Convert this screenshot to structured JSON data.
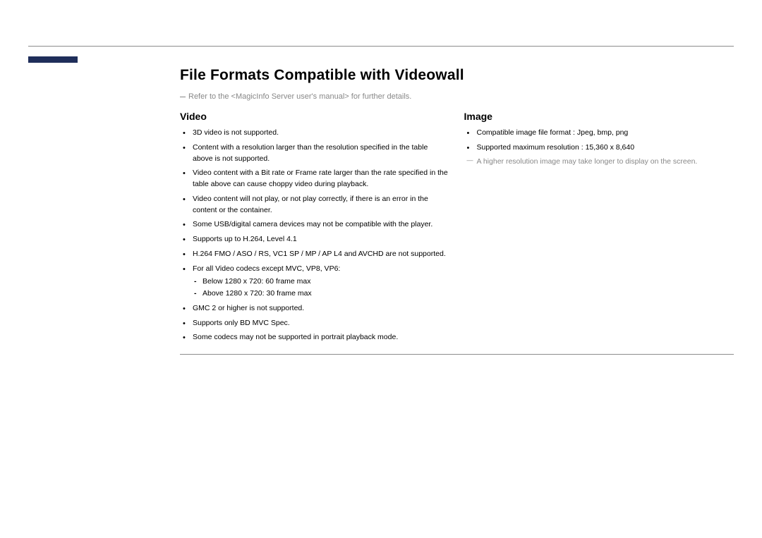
{
  "heading": "File Formats Compatible with Videowall",
  "note": "Refer to the <MagicInfo Server user's manual> for further details.",
  "video": {
    "title": "Video",
    "items": [
      "3D video is not supported.",
      "Content with a resolution larger than the resolution specified in the table above is not supported.",
      "Video content with a Bit rate or Frame rate larger than the rate specified in the table above can cause choppy video during playback.",
      "Video content will not play, or not play correctly, if there is an error in the content or the container.",
      "Some USB/digital camera devices may not be compatible with the player.",
      "Supports up to H.264, Level 4.1",
      "H.264 FMO / ASO / RS, VC1 SP / MP / AP L4 and AVCHD are not supported.",
      "For all Video codecs except MVC, VP8, VP6:",
      "GMC 2 or higher is not supported.",
      "Supports only BD MVC Spec.",
      "Some codecs may not be supported in portrait playback mode."
    ],
    "sub": [
      "Below 1280 x 720: 60 frame max",
      "Above 1280 x 720: 30 frame max"
    ]
  },
  "image": {
    "title": "Image",
    "items": [
      "Compatible image file format : Jpeg, bmp, png",
      "Supported maximum resolution : 15,360 x 8,640"
    ],
    "note": "A higher resolution image may take longer to display on the screen."
  }
}
